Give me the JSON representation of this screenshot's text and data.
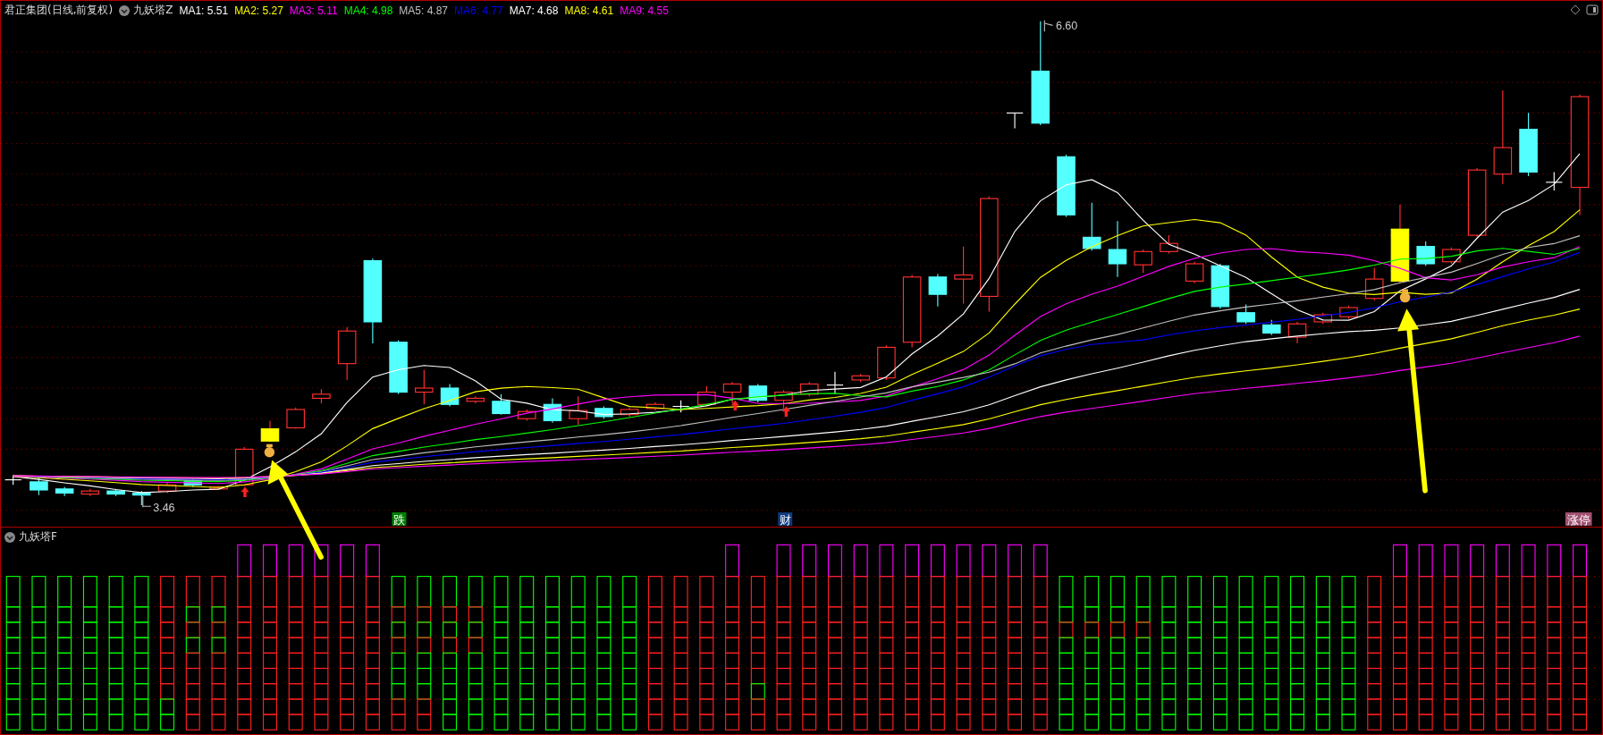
{
  "header": {
    "title": "君正集团(日线,前复权)",
    "indicator": "九妖塔Z",
    "moving_averages": [
      {
        "text": "MA1: 5.51",
        "color": "#ffffff"
      },
      {
        "text": "MA2: 5.27",
        "color": "#ffff00"
      },
      {
        "text": "MA3: 5.11",
        "color": "#ff00ff"
      },
      {
        "text": "MA4: 4.98",
        "color": "#00ff00"
      },
      {
        "text": "MA5: 4.87",
        "color": "#c0c0c0"
      },
      {
        "text": "MA6: 4.77",
        "color": "#0000ff"
      },
      {
        "text": "MA7: 4.68",
        "color": "#ffffff"
      },
      {
        "text": "MA8: 4.61",
        "color": "#ffff00"
      },
      {
        "text": "MA9: 4.55",
        "color": "#ff00ff"
      }
    ]
  },
  "price_marks": {
    "high": "6.60",
    "low": "3.46"
  },
  "signals": [
    {
      "text": "跌",
      "kind": "fall"
    },
    {
      "text": "财",
      "kind": "wealth"
    },
    {
      "text": "涨停",
      "kind": "limit-up"
    }
  ],
  "lower_panel": {
    "indicator": "九妖塔F"
  }
}
